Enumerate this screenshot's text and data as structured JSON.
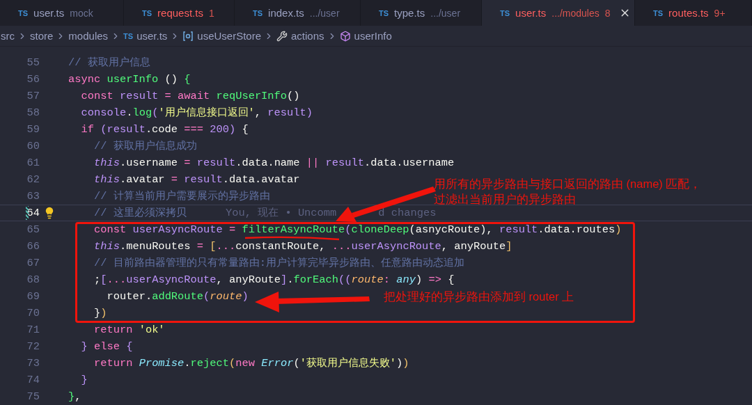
{
  "tabs": [
    {
      "icon": "TS",
      "label": "user.ts",
      "detail": "mock",
      "selected": false,
      "error": false
    },
    {
      "icon": "TS",
      "label": "request.ts",
      "badge": "1",
      "selected": false,
      "error": true
    },
    {
      "icon": "TS",
      "label": "index.ts",
      "detail": ".../user",
      "selected": false,
      "error": false
    },
    {
      "icon": "TS",
      "label": "type.ts",
      "detail": ".../user",
      "selected": false,
      "error": false
    },
    {
      "icon": "TS",
      "label": "user.ts",
      "detail": ".../modules",
      "badge": "8",
      "selected": true,
      "error": true
    },
    {
      "icon": "TS",
      "label": "routes.ts",
      "badge": "9+",
      "selected": false,
      "error": true
    }
  ],
  "breadcrumb": [
    {
      "kind": "folder",
      "label": "src"
    },
    {
      "kind": "folder",
      "label": "store"
    },
    {
      "kind": "folder",
      "label": "modules"
    },
    {
      "kind": "file",
      "icon": "TS",
      "label": "user.ts"
    },
    {
      "kind": "symbol",
      "label": "useUserStore"
    },
    {
      "kind": "method",
      "label": "actions"
    },
    {
      "kind": "property",
      "label": "userInfo"
    }
  ],
  "editor": {
    "lines": [
      {
        "number": "55",
        "current": false,
        "modified": false,
        "tokens": [
          {
            "kind": "comment",
            "text": "// 获取用户信息"
          }
        ]
      },
      {
        "number": "56",
        "current": false,
        "modified": false,
        "tokens": [
          {
            "kind": "keyword",
            "text": "async "
          },
          {
            "kind": "function",
            "text": "userInfo"
          },
          {
            "kind": "plain",
            "text": " () "
          },
          {
            "kind": "brace",
            "text": "{"
          }
        ],
        "children": [
          {
            "number": "57",
            "current": false,
            "modified": false,
            "tokens": [
              {
                "kind": "keyword",
                "text": "const "
              },
              {
                "kind": "variable",
                "text": "result "
              },
              {
                "kind": "keyword",
                "text": "= await "
              },
              {
                "kind": "function",
                "text": "reqUserInfo"
              },
              {
                "kind": "plain",
                "text": "()"
              }
            ]
          },
          {
            "number": "58",
            "current": false,
            "modified": false,
            "tokens": [
              {
                "kind": "variable",
                "text": "console"
              },
              {
                "kind": "plain",
                "text": "."
              },
              {
                "kind": "function",
                "text": "log"
              },
              {
                "kind": "variable",
                "text": "("
              },
              {
                "kind": "string",
                "text": "'用户信息接口返回'"
              },
              {
                "kind": "plain",
                "text": ", "
              },
              {
                "kind": "variable",
                "text": "result)"
              }
            ]
          },
          {
            "number": "59",
            "current": false,
            "modified": false,
            "tokens": [
              {
                "kind": "keyword",
                "text": "if "
              },
              {
                "kind": "variable",
                "text": "(result"
              },
              {
                "kind": "plain",
                "text": ".code "
              },
              {
                "kind": "keyword",
                "text": "=== "
              },
              {
                "kind": "variable",
                "text": "200)"
              },
              {
                "kind": "plain",
                "text": " {"
              }
            ],
            "children": [
              {
                "number": "60",
                "current": false,
                "modified": false,
                "tokens": [
                  {
                    "kind": "comment",
                    "text": "// 获取用户信息成功"
                  }
                ]
              },
              {
                "number": "61",
                "current": false,
                "modified": false,
                "tokens": [
                  {
                    "kind": "self",
                    "text": "this"
                  },
                  {
                    "kind": "plain",
                    "text": ".username "
                  },
                  {
                    "kind": "keyword",
                    "text": "= "
                  },
                  {
                    "kind": "variable",
                    "text": "result"
                  },
                  {
                    "kind": "plain",
                    "text": ".data.name "
                  },
                  {
                    "kind": "keyword",
                    "text": "|| "
                  },
                  {
                    "kind": "variable",
                    "text": "result"
                  },
                  {
                    "kind": "plain",
                    "text": ".data.username"
                  }
                ]
              },
              {
                "number": "62",
                "current": false,
                "modified": false,
                "tokens": [
                  {
                    "kind": "self",
                    "text": "this"
                  },
                  {
                    "kind": "plain",
                    "text": ".avatar "
                  },
                  {
                    "kind": "keyword",
                    "text": "= "
                  },
                  {
                    "kind": "variable",
                    "text": "result"
                  },
                  {
                    "kind": "plain",
                    "text": ".data.avatar"
                  }
                ]
              },
              {
                "number": "63",
                "current": false,
                "modified": false,
                "tokens": [
                  {
                    "kind": "comment",
                    "text": "// 计算当前用户需要展示的异步路由"
                  }
                ]
              },
              {
                "number": "64",
                "current": true,
                "modified": true,
                "blame": [
                  "You, 现在 • Uncomm",
                  "d changes"
                ],
                "tokens": [
                  {
                    "kind": "comment",
                    "text": "// 这里必须深拷贝"
                  }
                ]
              },
              {
                "number": "65",
                "current": false,
                "modified": false,
                "tokens": [
                  {
                    "kind": "keyword",
                    "text": "const "
                  },
                  {
                    "kind": "variable",
                    "text": "userAsyncRoute "
                  },
                  {
                    "kind": "keyword",
                    "text": "= "
                  },
                  {
                    "kind": "function",
                    "text": "filterAsyncRoute"
                  },
                  {
                    "kind": "variable",
                    "text": "("
                  },
                  {
                    "kind": "function",
                    "text": "cloneDeep"
                  },
                  {
                    "kind": "plain",
                    "text": "(asnycRoute), "
                  },
                  {
                    "kind": "variable",
                    "text": "result"
                  },
                  {
                    "kind": "plain",
                    "text": ".data.routes"
                  },
                  {
                    "kind": "bracket",
                    "text": ")"
                  }
                ]
              },
              {
                "number": "66",
                "current": false,
                "modified": false,
                "tokens": [
                  {
                    "kind": "self",
                    "text": "this"
                  },
                  {
                    "kind": "plain",
                    "text": ".menuRoutes "
                  },
                  {
                    "kind": "keyword",
                    "text": "= "
                  },
                  {
                    "kind": "bracket",
                    "text": "["
                  },
                  {
                    "kind": "keyword",
                    "text": "..."
                  },
                  {
                    "kind": "plain",
                    "text": "constantRoute, "
                  },
                  {
                    "kind": "keyword",
                    "text": "..."
                  },
                  {
                    "kind": "variable",
                    "text": "userAsyncRoute"
                  },
                  {
                    "kind": "plain",
                    "text": ", anyRoute"
                  },
                  {
                    "kind": "bracket",
                    "text": "]"
                  }
                ]
              },
              {
                "number": "67",
                "current": false,
                "modified": false,
                "tokens": [
                  {
                    "kind": "comment",
                    "text": "// 目前路由器管理的只有常量路由:用户计算完毕异步路由、任意路由动态追加"
                  }
                ]
              },
              {
                "number": "68",
                "current": false,
                "modified": false,
                "tokens": [
                  {
                    "kind": "plain",
                    "text": ";"
                  },
                  {
                    "kind": "variable",
                    "text": "["
                  },
                  {
                    "kind": "keyword",
                    "text": "..."
                  },
                  {
                    "kind": "variable",
                    "text": "userAsyncRoute"
                  },
                  {
                    "kind": "plain",
                    "text": ", anyRoute"
                  },
                  {
                    "kind": "variable",
                    "text": "]"
                  },
                  {
                    "kind": "plain",
                    "text": "."
                  },
                  {
                    "kind": "function",
                    "text": "forEach"
                  },
                  {
                    "kind": "variable",
                    "text": "(("
                  },
                  {
                    "kind": "param",
                    "text": "route"
                  },
                  {
                    "kind": "keyword",
                    "text": ": "
                  },
                  {
                    "kind": "type",
                    "text": "any"
                  },
                  {
                    "kind": "plain",
                    "text": ") "
                  },
                  {
                    "kind": "keyword",
                    "text": "=>"
                  },
                  {
                    "kind": "plain",
                    "text": " {"
                  }
                ],
                "children": [
                  {
                    "number": "69",
                    "current": false,
                    "modified": false,
                    "tokens": [
                      {
                        "kind": "plain",
                        "text": "router."
                      },
                      {
                        "kind": "function",
                        "text": "addRoute"
                      },
                      {
                        "kind": "variable",
                        "text": "("
                      },
                      {
                        "kind": "param",
                        "text": "route"
                      },
                      {
                        "kind": "variable",
                        "text": ")"
                      }
                    ]
                  }
                ]
              },
              {
                "number": "70",
                "current": false,
                "modified": false,
                "tokens": [
                  {
                    "kind": "plain",
                    "text": "}"
                  },
                  {
                    "kind": "bracket",
                    "text": ")"
                  }
                ]
              },
              {
                "number": "71",
                "current": false,
                "modified": false,
                "tokens": [
                  {
                    "kind": "keyword",
                    "text": "return "
                  },
                  {
                    "kind": "string",
                    "text": "'ok'"
                  }
                ]
              }
            ]
          },
          {
            "number": "72",
            "current": false,
            "modified": false,
            "tokens": [
              {
                "kind": "variable",
                "text": "}"
              },
              {
                "kind": "keyword",
                "text": " else "
              },
              {
                "kind": "variable",
                "text": "{"
              }
            ],
            "children": [
              {
                "number": "73",
                "current": false,
                "modified": false,
                "tokens": [
                  {
                    "kind": "keyword",
                    "text": "return "
                  },
                  {
                    "kind": "type",
                    "text": "Promise"
                  },
                  {
                    "kind": "plain",
                    "text": "."
                  },
                  {
                    "kind": "function",
                    "text": "reject"
                  },
                  {
                    "kind": "bracket",
                    "text": "("
                  },
                  {
                    "kind": "keyword",
                    "text": "new "
                  },
                  {
                    "kind": "type",
                    "text": "Error"
                  },
                  {
                    "kind": "plain",
                    "text": "("
                  },
                  {
                    "kind": "string",
                    "text": "'获取用户信息失败'"
                  },
                  {
                    "kind": "plain",
                    "text": ")"
                  },
                  {
                    "kind": "bracket",
                    "text": ")"
                  }
                ]
              }
            ]
          },
          {
            "number": "74",
            "current": false,
            "modified": false,
            "tokens": [
              {
                "kind": "variable",
                "text": "}"
              }
            ]
          }
        ]
      },
      {
        "number": "75",
        "current": false,
        "modified": false,
        "tokens": [
          {
            "kind": "brace",
            "text": "}"
          },
          {
            "kind": "plain",
            "text": ","
          }
        ]
      }
    ],
    "annotations": [
      {
        "text": "用所有的异步路由与接口返回的路由 (name) 匹配，"
      },
      {
        "text": "过滤出当前用户的异步路由"
      },
      {
        "text": "把处理好的异步路由添加到 router 上"
      }
    ]
  }
}
